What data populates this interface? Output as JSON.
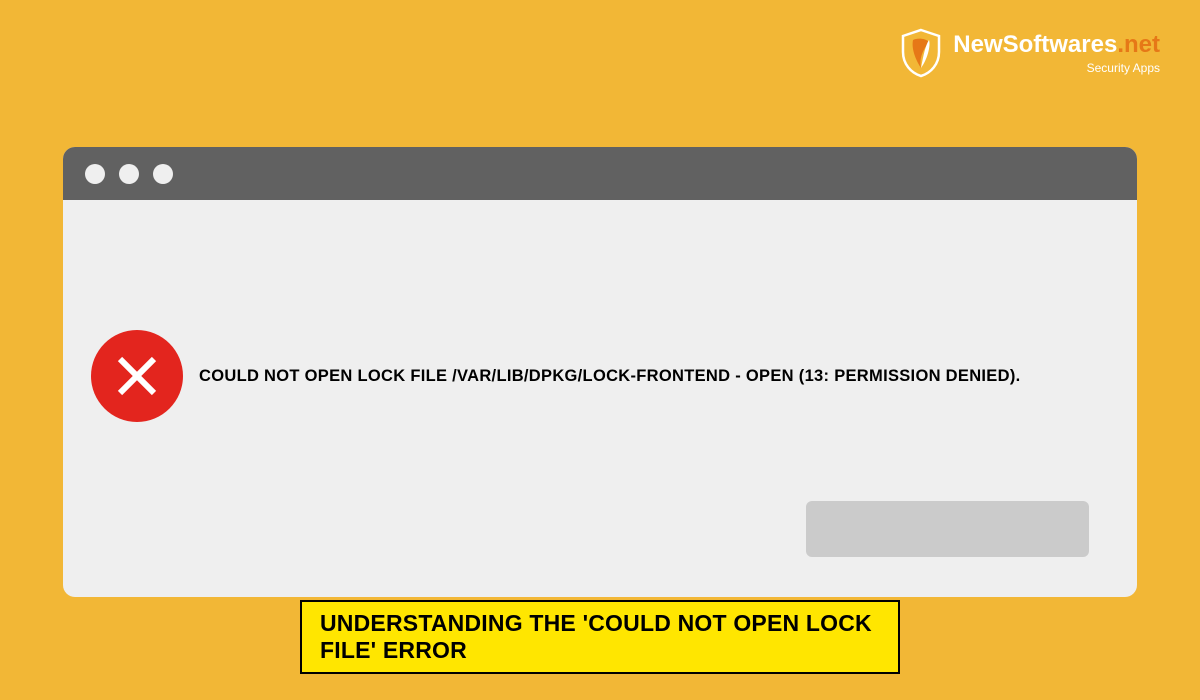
{
  "logo": {
    "brand_left": "NewSoftwares",
    "brand_right": ".net",
    "tagline": "Security Apps"
  },
  "dialog": {
    "error_message": "COULD NOT OPEN LOCK FILE /VAR/LIB/DPKG/LOCK-FRONTEND - OPEN (13: PERMISSION DENIED)."
  },
  "caption": {
    "text": "UNDERSTANDING THE 'COULD NOT OPEN LOCK FILE' ERROR"
  }
}
